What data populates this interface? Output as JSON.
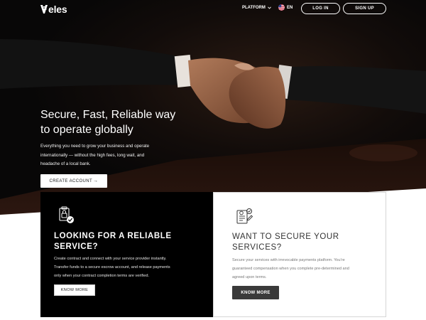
{
  "nav": {
    "logo": "eles",
    "platform_label": "PLATFORM",
    "language": "EN",
    "login_label": "LOG IN",
    "signup_label": "SIGN UP"
  },
  "hero": {
    "headline_line1": "Secure, Fast, Reliable way",
    "headline_line2": "to operate globally",
    "subtext_line1": "Everything you need to grow your business and operate",
    "subtext_line2": "internationally — without the high fees, long wait, and",
    "subtext_line3": "headache of a local bank.",
    "cta_label": "CREATE ACCOUNT",
    "cta_arrow": "→"
  },
  "cards": {
    "left": {
      "icon": "secure-document-icon",
      "title_line1": "LOOKING FOR A RELIABLE",
      "title_line2": "SERVICE?",
      "text_line1": "Create contract and connect with your service provider instantly.",
      "text_line2": "Transfer funds to a secure escrow account, and release payments",
      "text_line3": "only when your contract completion terms are verified.",
      "button_label": "KNOW MORE"
    },
    "right": {
      "icon": "contract-checklist-icon",
      "title_line1": "WANT TO SECURE YOUR",
      "title_line2": "SERVICES?",
      "text_line1": "Secure your services with irrevocable payments platform. You're",
      "text_line2": "guaranteed compensation when you complete pre-determined and",
      "text_line3": "agreed upon terms.",
      "button_label": "KNOW MORE"
    }
  },
  "colors": {
    "hero_bg": "#0a0909",
    "dark_card": "#000000",
    "dark_button": "#3a3a3a",
    "white": "#ffffff"
  }
}
